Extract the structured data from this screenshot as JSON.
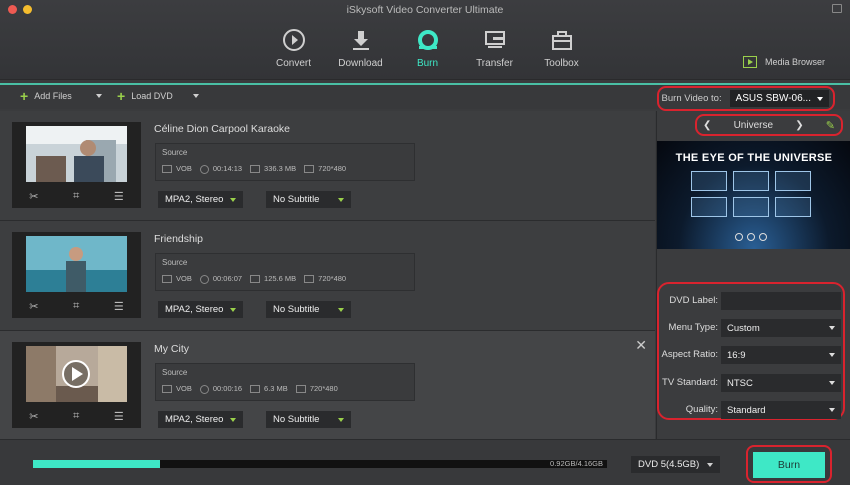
{
  "window": {
    "title": "iSkysoft Video Converter Ultimate"
  },
  "nav": [
    {
      "label": "Convert",
      "icon": "convert-icon"
    },
    {
      "label": "Download",
      "icon": "download-icon"
    },
    {
      "label": "Burn",
      "icon": "burn-icon",
      "active": true
    },
    {
      "label": "Transfer",
      "icon": "transfer-icon"
    },
    {
      "label": "Toolbox",
      "icon": "toolbox-icon"
    }
  ],
  "media_browser": "Media Browser",
  "actions": {
    "add_files": "Add Files",
    "load_dvd": "Load DVD"
  },
  "burn_to": {
    "label": "Burn Video to:",
    "device": "ASUS SBW-06..."
  },
  "items": [
    {
      "title": "Céline Dion Carpool Karaoke",
      "source_label": "Source",
      "format": "VOB",
      "duration": "00:14:13",
      "size": "336.3 MB",
      "resolution": "720*480",
      "audio": "MPA2, Stereo",
      "subtitle": "No Subtitle"
    },
    {
      "title": "Friendship",
      "source_label": "Source",
      "format": "VOB",
      "duration": "00:06:07",
      "size": "125.6 MB",
      "resolution": "720*480",
      "audio": "MPA2, Stereo",
      "subtitle": "No Subtitle"
    },
    {
      "title": "My City",
      "source_label": "Source",
      "format": "VOB",
      "duration": "00:00:16",
      "size": "6.3 MB",
      "resolution": "720*480",
      "audio": "MPA2, Stereo",
      "subtitle": "No Subtitle"
    }
  ],
  "template": {
    "name": "Universe",
    "preview_title": "THE EYE OF THE UNIVERSE"
  },
  "settings": {
    "dvd_label": {
      "label": "DVD Label:",
      "value": ""
    },
    "menu_type": {
      "label": "Menu Type:",
      "value": "Custom"
    },
    "aspect_ratio": {
      "label": "Aspect Ratio:",
      "value": "16:9"
    },
    "tv_standard": {
      "label": "TV Standard:",
      "value": "NTSC"
    },
    "quality": {
      "label": "Quality:",
      "value": "Standard"
    }
  },
  "bottom": {
    "usage": "0.92GB/4.16GB",
    "usage_fraction": 0.221,
    "disc": "DVD 5(4.5GB)",
    "burn": "Burn"
  },
  "colors": {
    "accent": "#3ee8c6",
    "highlight_box": "#d9232e"
  }
}
